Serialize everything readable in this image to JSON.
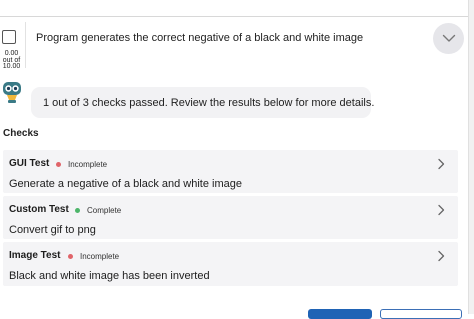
{
  "question": {
    "text": "Program generates the correct negative of a black and white image",
    "score_line1": "0.00",
    "score_line2": "out of",
    "score_line3": "10.00"
  },
  "summary": {
    "message": "1 out of 3 checks passed. Review the results below for more details."
  },
  "checks_heading": "Checks",
  "checks": [
    {
      "title": "GUI Test",
      "status": "Incomplete",
      "status_color": "#e06469",
      "description": "Generate a negative of a black and white image"
    },
    {
      "title": "Custom Test",
      "status": "Complete",
      "status_color": "#4db56a",
      "description": "Convert gif to png"
    },
    {
      "title": "Image Test",
      "status": "Incomplete",
      "status_color": "#e06469",
      "description": "Black and white image has been inverted"
    }
  ],
  "colors": {
    "accent": "#1f63b5",
    "row_background": "#f4f4f6"
  },
  "icons": {
    "expand": "chevron-down-icon",
    "row": "chevron-right-icon",
    "feedback": "robot-icon"
  }
}
